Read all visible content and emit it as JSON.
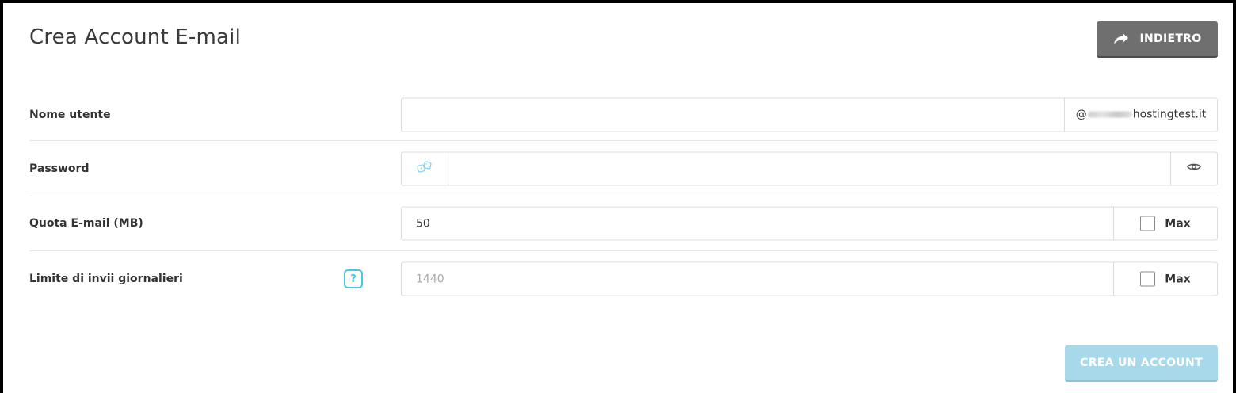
{
  "header": {
    "title": "Crea Account E-mail",
    "back_label": "INDIETRO"
  },
  "form": {
    "username": {
      "label": "Nome utente",
      "value": "",
      "domain_prefix": "@",
      "domain_suffix": "hostingtest.it"
    },
    "password": {
      "label": "Password",
      "value": "",
      "generate_icon": "dice-icon",
      "toggle_icon": "eye-icon"
    },
    "quota": {
      "label": "Quota E-mail (MB)",
      "value": "50",
      "max_label": "Max",
      "max_checked": false
    },
    "daily_limit": {
      "label": "Limite di invii giornalieri",
      "help_symbol": "?",
      "placeholder": "1440",
      "max_label": "Max",
      "max_checked": false
    }
  },
  "actions": {
    "submit_label": "CREA UN ACCOUNT"
  },
  "colors": {
    "back_button": "#6f6f6f",
    "submit_button_disabled": "#a8d9ea",
    "help_accent": "#49c6e5"
  }
}
